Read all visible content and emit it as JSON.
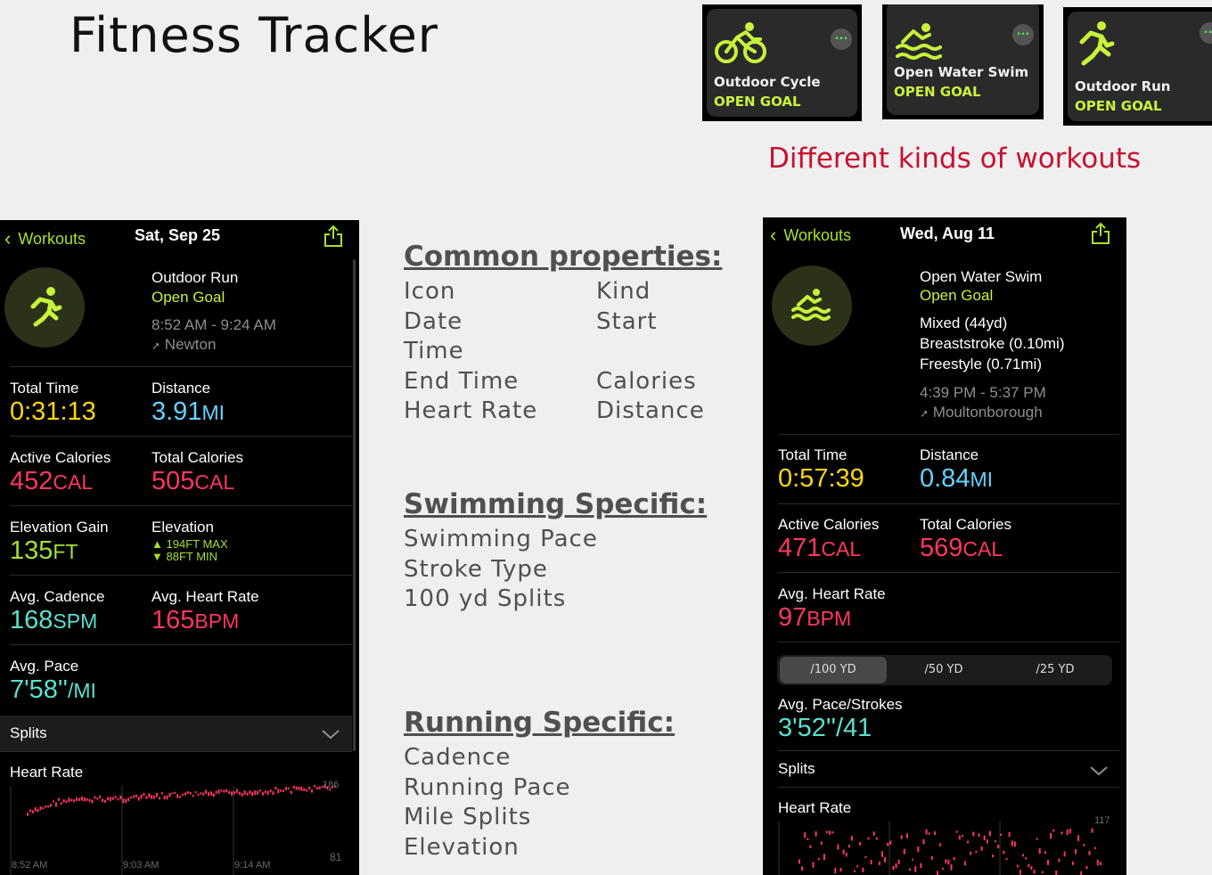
{
  "slide": {
    "title": "Fitness Tracker",
    "caption": "Different kinds of workouts",
    "caption_color": "#c8102e"
  },
  "watch_tiles": [
    {
      "icon": "cycling-icon",
      "name": "Outdoor Cycle",
      "goal": "OPEN GOAL",
      "more": "..."
    },
    {
      "icon": "swimming-icon",
      "name": "Open Water Swim",
      "goal": "OPEN GOAL",
      "more": "..."
    },
    {
      "icon": "running-icon",
      "name": "Outdoor Run",
      "goal": "OPEN GOAL",
      "more": "..."
    }
  ],
  "run_screen": {
    "back_label": "Workouts",
    "date": "Sat, Sep 25",
    "workout_name": "Outdoor Run",
    "goal": "Open Goal",
    "time_range": "8:52 AM - 9:24 AM",
    "location": "Newton",
    "total_time": {
      "label": "Total Time",
      "value": "0:31:13"
    },
    "distance": {
      "label": "Distance",
      "value": "3.91",
      "unit": "MI"
    },
    "active_calories": {
      "label": "Active Calories",
      "value": "452",
      "unit": "CAL"
    },
    "total_calories": {
      "label": "Total Calories",
      "value": "505",
      "unit": "CAL"
    },
    "elevation_gain": {
      "label": "Elevation Gain",
      "value": "135",
      "unit": "FT"
    },
    "elevation": {
      "label": "Elevation",
      "max": "194FT MAX",
      "min": "88FT MIN"
    },
    "avg_cadence": {
      "label": "Avg. Cadence",
      "value": "168",
      "unit": "SPM"
    },
    "avg_heart_rate": {
      "label": "Avg. Heart Rate",
      "value": "165",
      "unit": "BPM"
    },
    "avg_pace": {
      "label": "Avg. Pace",
      "value": "7'58''",
      "unit": "/MI"
    },
    "splits_label": "Splits",
    "heart_rate_label": "Heart Rate",
    "hr_max": "186",
    "hr_min": "81",
    "hr_times": [
      "8:52 AM",
      "9:03 AM",
      "9:14 AM"
    ]
  },
  "swim_screen": {
    "back_label": "Workouts",
    "date": "Wed, Aug 11",
    "workout_name": "Open Water Swim",
    "goal": "Open Goal",
    "strokes": [
      "Mixed (44yd)",
      "Breaststroke (0.10mi)",
      "Freestyle (0.71mi)"
    ],
    "time_range": "4:39 PM - 5:37 PM",
    "location": "Moultonborough",
    "total_time": {
      "label": "Total Time",
      "value": "0:57:39"
    },
    "distance": {
      "label": "Distance",
      "value": "0.84",
      "unit": "MI"
    },
    "active_calories": {
      "label": "Active Calories",
      "value": "471",
      "unit": "CAL"
    },
    "total_calories": {
      "label": "Total Calories",
      "value": "569",
      "unit": "CAL"
    },
    "avg_heart_rate": {
      "label": "Avg. Heart Rate",
      "value": "97",
      "unit": "BPM"
    },
    "split_options": [
      "/100 YD",
      "/50 YD",
      "/25 YD"
    ],
    "split_selected": "/100 YD",
    "avg_pace_strokes": {
      "label": "Avg. Pace/Strokes",
      "value": "3'52''/41"
    },
    "splits_label": "Splits",
    "heart_rate_label": "Heart Rate",
    "hr_max": "117"
  },
  "common": {
    "heading": "Common properties:",
    "items_left": [
      "Icon",
      "Date",
      "Time",
      "End Time",
      "Heart Rate"
    ],
    "items_right": [
      "Kind",
      "Start",
      "",
      "Calories",
      "Distance"
    ]
  },
  "swimming": {
    "heading": "Swimming Specific:",
    "items": [
      "Swimming Pace",
      "Stroke Type",
      "100 yd Splits"
    ]
  },
  "running": {
    "heading": "Running Specific:",
    "items": [
      "Cadence",
      "Running Pace",
      "Mile Splits",
      "Elevation"
    ]
  },
  "colors": {
    "yellow": "#ffd60a",
    "cyan": "#64d2ff",
    "red": "#ff375f",
    "green": "#a6e22e",
    "teal": "#5ae0d0",
    "lime": "#c8f23a"
  }
}
